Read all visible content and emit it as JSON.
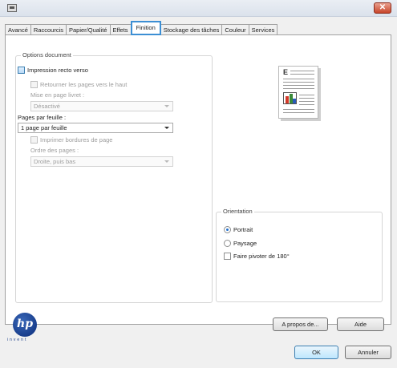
{
  "window": {
    "close_label": "✕"
  },
  "tabs": [
    {
      "label": "Avancé"
    },
    {
      "label": "Raccourcis"
    },
    {
      "label": "Papier/Qualité"
    },
    {
      "label": "Effets"
    },
    {
      "label": "Finition"
    },
    {
      "label": "Stockage des tâches"
    },
    {
      "label": "Couleur"
    },
    {
      "label": "Services"
    }
  ],
  "active_tab": "Finition",
  "document_options": {
    "legend": "Options document",
    "duplex_label": "Impression recto verso",
    "flip_label": "Retourner les pages vers le haut",
    "booklet_label": "Mise en page livret :",
    "booklet_value": "Désactivé",
    "pages_per_sheet_label": "Pages par feuille :",
    "pages_per_sheet_value": "1 page par feuille",
    "print_borders_label": "Imprimer bordures de page",
    "page_order_label": "Ordre des pages :",
    "page_order_value": "Droite, puis bas"
  },
  "orientation": {
    "legend": "Orientation",
    "portrait_label": "Portrait",
    "landscape_label": "Paysage",
    "rotate_label": "Faire pivoter de 180°",
    "selected": "Portrait"
  },
  "preview": {
    "letter": "E"
  },
  "footer": {
    "logo_text": "hp",
    "logo_tagline": "invent",
    "about_label": "A propos de...",
    "help_label": "Aide",
    "ok_label": "OK",
    "cancel_label": "Annuler"
  }
}
